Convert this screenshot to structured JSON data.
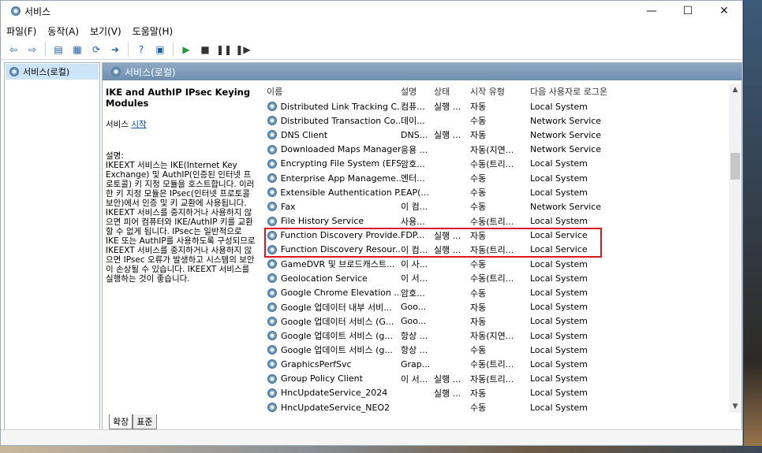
{
  "window": {
    "title": "서비스",
    "controls": {
      "minimize": "—",
      "maximize": "☐",
      "close": "✕"
    }
  },
  "menu": [
    "파일(F)",
    "동작(A)",
    "보기(V)",
    "도움말(H)"
  ],
  "toolbar": {
    "icons": [
      "back-icon",
      "forward-icon",
      "show-tree-icon",
      "properties-icon",
      "refresh-icon",
      "export-icon",
      "help-icon",
      "console-icon",
      "start-icon",
      "stop-icon",
      "pause-icon",
      "restart-icon"
    ]
  },
  "tree": {
    "root_label": "서비스(로컬)"
  },
  "pane": {
    "header": "서비스(로컬)"
  },
  "detail": {
    "service_name": "IKE and AuthIP IPsec Keying Modules",
    "start_prefix": "서비스 ",
    "start_link": "시작",
    "description_heading": "설명:",
    "description": "IKEEXT 서비스는 IKE(Internet Key Exchange) 및 AuthIP(인증된 인터넷 프로토콜) 키 지정 모듈을 호스트합니다. 이러한 키 지정 모듈은 IPsec(인터넷 프로토콜 보안)에서 인증 및 키 교환에 사용됩니다. IKEEXT 서비스를 중지하거나 사용하지 않으면 피어 컴퓨터와 IKE/AuthIP 키를 교환할 수 없게 됩니다. IPsec는 일반적으로 IKE 또는 AuthIP를 사용하도록 구성되므로 IKEEXT 서비스를 중지하거나 사용하지 않으면 IPsec 오류가 발생하고 시스템의 보안이 손상될 수 있습니다. IKEEXT 서비스를 실행하는 것이 좋습니다."
  },
  "columns": {
    "name": "이름",
    "description": "설명",
    "status": "상태",
    "startup": "시작 유형",
    "logon": "다음 사용자로 로그온"
  },
  "rows": [
    {
      "name": "Distributed Link Tracking C...",
      "description": "컴퓨...",
      "status": "실행 ...",
      "startup": "자동",
      "logon": "Local System"
    },
    {
      "name": "Distributed Transaction Co...",
      "description": "데이...",
      "status": "",
      "startup": "수동",
      "logon": "Network Service"
    },
    {
      "name": "DNS Client",
      "description": "DNS...",
      "status": "실행 ...",
      "startup": "자동",
      "logon": "Network Service"
    },
    {
      "name": "Downloaded Maps Manager",
      "description": "응용 ...",
      "status": "",
      "startup": "자동(지연...",
      "logon": "Network Service"
    },
    {
      "name": "Encrypting File System (EFS)",
      "description": "암호...",
      "status": "",
      "startup": "수동(트리...",
      "logon": "Local System"
    },
    {
      "name": "Enterprise App Manageme...",
      "description": "엔터...",
      "status": "",
      "startup": "수동",
      "logon": "Local System"
    },
    {
      "name": "Extensible Authentication P...",
      "description": "EAP(...",
      "status": "",
      "startup": "수동",
      "logon": "Local System"
    },
    {
      "name": "Fax",
      "description": "이 컴...",
      "status": "",
      "startup": "수동",
      "logon": "Network Service"
    },
    {
      "name": "File History Service",
      "description": "사용...",
      "status": "",
      "startup": "수동(트리...",
      "logon": "Local System"
    },
    {
      "name": "Function Discovery Provide...",
      "description": "FDP...",
      "status": "실행 ...",
      "startup": "자동",
      "logon": "Local Service"
    },
    {
      "name": "Function Discovery Resour...",
      "description": "이 컴...",
      "status": "실행 ...",
      "startup": "자동(트리...",
      "logon": "Local Service"
    },
    {
      "name": "GameDVR 및 브로드캐스트...",
      "description": "이 사...",
      "status": "",
      "startup": "수동",
      "logon": "Local System"
    },
    {
      "name": "Geolocation Service",
      "description": "이 서...",
      "status": "",
      "startup": "수동(트리...",
      "logon": "Local System"
    },
    {
      "name": "Google Chrome Elevation ...",
      "description": "암호...",
      "status": "",
      "startup": "수동",
      "logon": "Local System"
    },
    {
      "name": "Google 업데이터 내부 서비...",
      "description": "Goo...",
      "status": "",
      "startup": "자동",
      "logon": "Local System"
    },
    {
      "name": "Google 업데이터 서비스 (G...",
      "description": "Goo...",
      "status": "",
      "startup": "자동",
      "logon": "Local System"
    },
    {
      "name": "Google 업데이트 서비스 (g...",
      "description": "항상 ...",
      "status": "",
      "startup": "자동(지연...",
      "logon": "Local System"
    },
    {
      "name": "Google 업데이트 서비스 (g...",
      "description": "항상 ...",
      "status": "",
      "startup": "수동",
      "logon": "Local System"
    },
    {
      "name": "GraphicsPerfSvc",
      "description": "Grap...",
      "status": "",
      "startup": "수동(트리...",
      "logon": "Local System"
    },
    {
      "name": "Group Policy Client",
      "description": "이 서...",
      "status": "실행 ...",
      "startup": "자동(트리...",
      "logon": "Local System"
    },
    {
      "name": "HncUpdateService_2024",
      "description": "",
      "status": "실행 ...",
      "startup": "자동",
      "logon": "Local System"
    },
    {
      "name": "HncUpdateService_NEO2",
      "description": "",
      "status": "",
      "startup": "수동",
      "logon": "Local System"
    }
  ],
  "tabs": [
    "확장",
    "표준"
  ],
  "colors": {
    "highlight": "#e0141a",
    "header_blue": "#7f9cba",
    "tree_selected": "#cde4f7"
  }
}
